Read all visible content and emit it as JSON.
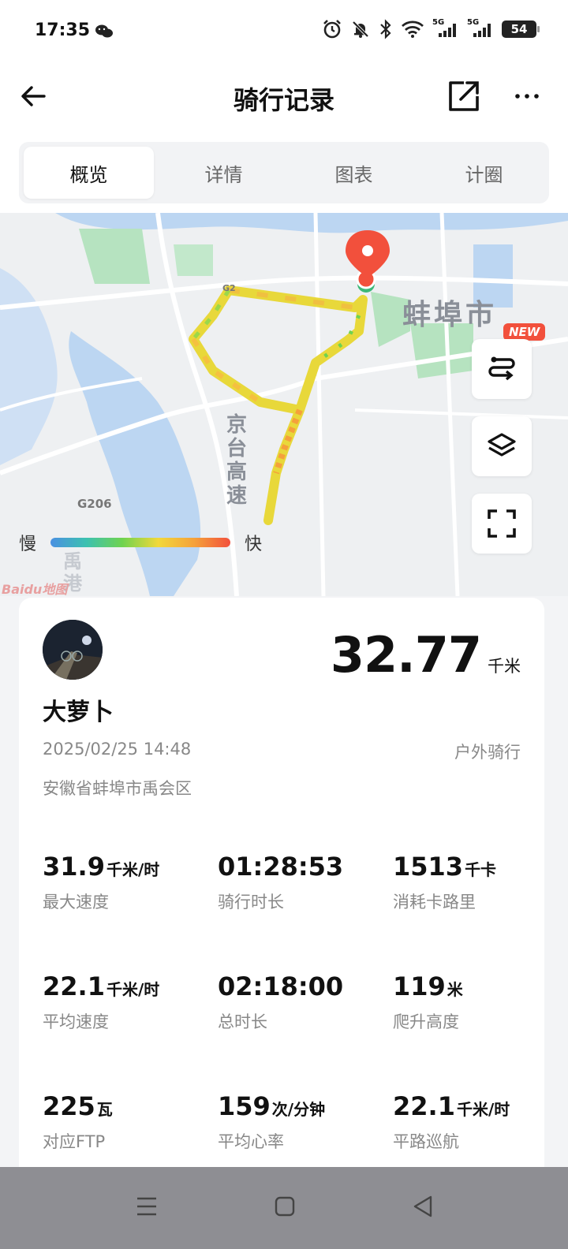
{
  "status_bar": {
    "time": "17:35",
    "battery": "54",
    "network1": "5G",
    "network2": "5G"
  },
  "header": {
    "title": "骑行记录"
  },
  "tabs": [
    {
      "label": "概览",
      "active": true
    },
    {
      "label": "详情",
      "active": false
    },
    {
      "label": "图表",
      "active": false
    },
    {
      "label": "计圈",
      "active": false
    }
  ],
  "map": {
    "city_label": "蚌埠市",
    "road_label": "京台高速",
    "g206_label": "G206",
    "g2_label": "G2",
    "district_label": "禹港",
    "watermark": "Baidu地图",
    "legend_slow": "慢",
    "legend_fast": "快",
    "new_badge": "NEW"
  },
  "summary": {
    "user_name": "大萝卜",
    "distance": "32.77",
    "distance_unit": "千米",
    "datetime": "2025/02/25 14:48",
    "activity_type": "户外骑行",
    "location": "安徽省蚌埠市禹会区"
  },
  "stats": [
    {
      "value": "31.9",
      "unit": "千米/时",
      "label": "最大速度"
    },
    {
      "value": "01:28:53",
      "unit": "",
      "label": "骑行时长"
    },
    {
      "value": "1513",
      "unit": "千卡",
      "label": "消耗卡路里"
    },
    {
      "value": "22.1",
      "unit": "千米/时",
      "label": "平均速度"
    },
    {
      "value": "02:18:00",
      "unit": "",
      "label": "总时长"
    },
    {
      "value": "119",
      "unit": "米",
      "label": "爬升高度"
    },
    {
      "value": "225",
      "unit": "瓦",
      "label": "对应FTP"
    },
    {
      "value": "159",
      "unit": "次/分钟",
      "label": "平均心率"
    },
    {
      "value": "22.1",
      "unit": "千米/时",
      "label": "平路巡航"
    }
  ],
  "colors": {
    "accent": "#f2503c",
    "route_fast": "#f5a13a",
    "route_mid": "#e8d83a",
    "route_slow": "#6fd34f"
  }
}
